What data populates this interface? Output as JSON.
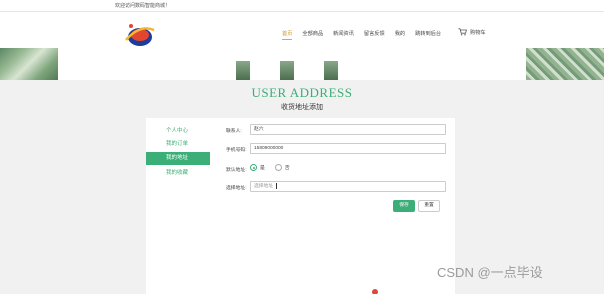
{
  "topbar": {
    "welcome_text": "欢迎访问数码智能商城！"
  },
  "nav": {
    "items": [
      {
        "label": "首页",
        "active": true
      },
      {
        "label": "全部商品",
        "active": false
      },
      {
        "label": "新闻资讯",
        "active": false
      },
      {
        "label": "留言反馈",
        "active": false
      },
      {
        "label": "我的",
        "active": false
      },
      {
        "label": "跳转到后台",
        "active": false
      }
    ],
    "cart_label": "购物车"
  },
  "page": {
    "title_en": "USER ADDRESS",
    "title_cn": "收货地址添加"
  },
  "sidebar": {
    "items": [
      {
        "label": "个人中心",
        "active": false
      },
      {
        "label": "我的订单",
        "active": false
      },
      {
        "label": "我的地址",
        "active": true
      },
      {
        "label": "我的收藏",
        "active": false
      }
    ]
  },
  "form": {
    "contact_label": "联系人:",
    "contact_value": "赵六",
    "phone_label": "手机号码:",
    "phone_value": "15809000000",
    "default_label": "默认地址:",
    "default_options": [
      "是",
      "否"
    ],
    "default_selected": "是",
    "address_label": "选择地址:",
    "address_placeholder": "选择地址",
    "save_button": "保存",
    "reset_button": "重置"
  },
  "watermark": "CSDN @一点毕设",
  "colors": {
    "accent": "#3cae77",
    "nav_active": "#c79b2c"
  }
}
